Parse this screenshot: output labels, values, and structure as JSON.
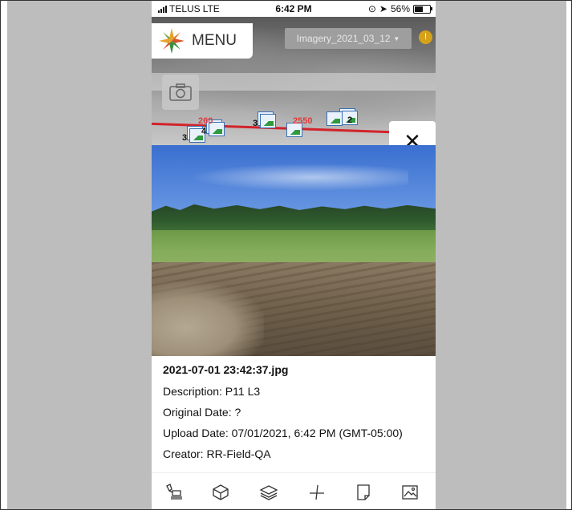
{
  "status_bar": {
    "carrier": "TELUS",
    "network": "LTE",
    "time": "6:42 PM",
    "battery": "56%"
  },
  "header": {
    "menu_label": "MENU",
    "imagery_selector": "Imagery_2021_03_12",
    "info_symbol": "!"
  },
  "map": {
    "markers": [
      {
        "count": "3",
        "icon": "photo-stack-icon"
      },
      {
        "count": "4",
        "icon": "photo-stack-icon"
      },
      {
        "count": "3",
        "icon": "photo-stack-icon"
      },
      {
        "count": "2",
        "icon": "photo-stack-icon"
      }
    ],
    "labels": [
      "2550",
      "260"
    ]
  },
  "photo_details": {
    "filename": "2021-07-01 23:42:37.jpg",
    "description": "Description: P11 L3",
    "original_date": "Original Date: ?",
    "upload_date": "Upload Date: 07/01/2021, 6:42 PM (GMT-05:00)",
    "creator": "Creator: RR-Field-QA"
  },
  "toolbar": {
    "items": [
      "excavator-icon",
      "cube-icon",
      "layers-icon",
      "measure-icon",
      "note-icon",
      "image-icon"
    ]
  },
  "colors": {
    "route": "#d2232a",
    "info_badge": "#d5a21a",
    "side_panel": "#bdbdbd"
  }
}
